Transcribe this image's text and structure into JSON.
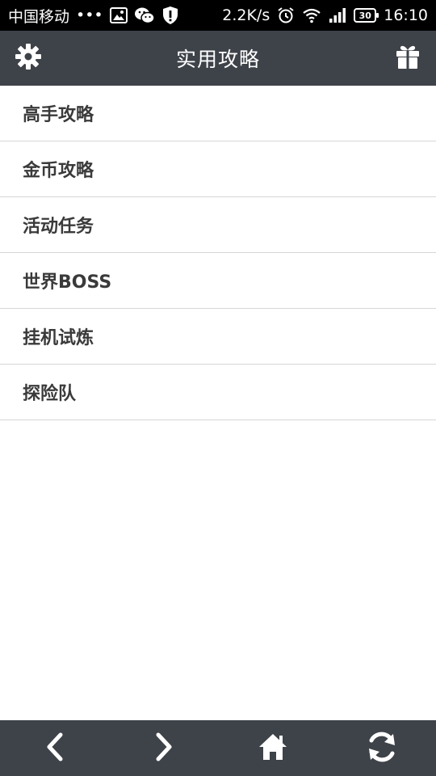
{
  "status_bar": {
    "carrier": "中国移动",
    "dots": "•••",
    "speed": "2.2K/s",
    "battery": "30",
    "time": "16:10"
  },
  "header": {
    "title": "实用攻略"
  },
  "menu": {
    "items": [
      {
        "label": "高手攻略"
      },
      {
        "label": "金币攻略"
      },
      {
        "label": "活动任务"
      },
      {
        "label": "世界BOSS"
      },
      {
        "label": "挂机试炼"
      },
      {
        "label": "探险队"
      }
    ]
  },
  "bottom_nav": {
    "icons": [
      "back-icon",
      "forward-icon",
      "home-icon",
      "refresh-icon"
    ]
  },
  "colors": {
    "header_bg": "#3e4249",
    "status_bg": "#000000",
    "text": "#3a3a3a",
    "divider": "#d6d6d6"
  }
}
